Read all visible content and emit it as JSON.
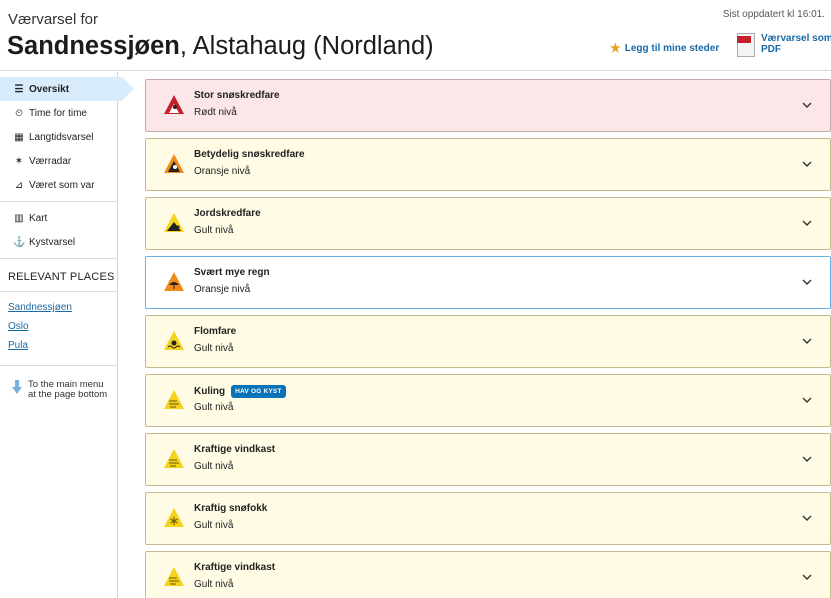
{
  "header": {
    "pre_title": "Værvarsel for",
    "place_bold": "Sandnessjøen",
    "place_rest": ", Alstahaug (Nordland)",
    "updated": "Sist oppdatert kl 16:01.",
    "favorite_label": "Legg til mine steder",
    "pdf_label": "Værvarsel som PDF"
  },
  "sidebar": {
    "nav": [
      {
        "label": "Oversikt",
        "icon": "list-icon"
      },
      {
        "label": "Time for time",
        "icon": "clock-icon"
      },
      {
        "label": "Langtidsvarsel",
        "icon": "calendar-icon"
      },
      {
        "label": "Værradar",
        "icon": "satellite-icon"
      },
      {
        "label": "Været som var",
        "icon": "chart-icon"
      },
      {
        "label": "Kart",
        "icon": "map-icon"
      },
      {
        "label": "Kystvarsel",
        "icon": "anchor-icon"
      }
    ],
    "relevant_title": "RELEVANT PLACES",
    "places": [
      "Sandnessjøen",
      "Oslo",
      "Pula"
    ],
    "to_menu": "To the main menu at the page bottom"
  },
  "warnings": [
    {
      "title": "Stor snøskredfare",
      "level": "Rødt nivå",
      "icon": "avalanche-icon",
      "color": "#c8202b"
    },
    {
      "title": "Betydelig snøskredfare",
      "level": "Oransje nivå",
      "icon": "avalanche-icon",
      "color": "#f08a1c"
    },
    {
      "title": "Jordskredfare",
      "level": "Gult nivå",
      "icon": "landslide-icon",
      "color": "#f5d21c"
    },
    {
      "title": "Svært mye regn",
      "level": "Oransje nivå",
      "icon": "umbrella-icon",
      "color": "#f08a1c"
    },
    {
      "title": "Flomfare",
      "level": "Gult nivå",
      "icon": "flood-icon",
      "color": "#f5d21c"
    },
    {
      "title": "Kuling",
      "level": "Gult nivå",
      "icon": "wind-icon",
      "color": "#f5d21c",
      "tag": "HAV OG KYST"
    },
    {
      "title": "Kraftige vindkast",
      "level": "Gult nivå",
      "icon": "wind-icon",
      "color": "#f5d21c"
    },
    {
      "title": "Kraftig snøfokk",
      "level": "Gult nivå",
      "icon": "snowflake-icon",
      "color": "#f5d21c"
    },
    {
      "title": "Kraftige vindkast",
      "level": "Gult nivå",
      "icon": "wind-icon",
      "color": "#f5d21c"
    }
  ]
}
